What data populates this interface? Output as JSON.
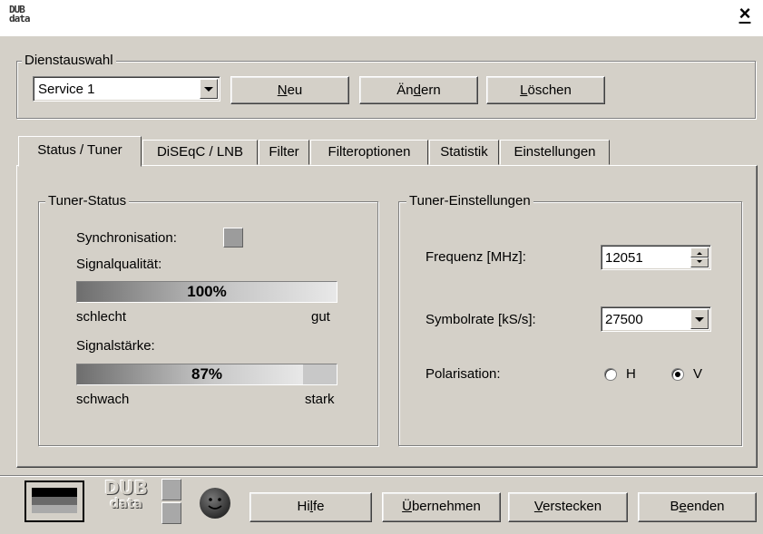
{
  "titlebar": {
    "logo_line1": "DUB",
    "logo_line2": "data",
    "close_label": "×"
  },
  "dienstauswahl": {
    "legend": "Dienstauswahl",
    "service_value": "Service 1",
    "btn_neu": {
      "pre": "",
      "u": "N",
      "post": "eu"
    },
    "btn_aendern": {
      "pre": "Än",
      "u": "d",
      "post": "ern"
    },
    "btn_loeschen": {
      "pre": "",
      "u": "L",
      "post": "öschen"
    }
  },
  "tabs": [
    "Status / Tuner",
    "DiSEqC / LNB",
    "Filter",
    "Filteroptionen",
    "Statistik",
    "Einstellungen"
  ],
  "tuner_status": {
    "legend": "Tuner-Status",
    "sync_label": "Synchronisation:",
    "quality_label": "Signalqualität:",
    "quality_value": 100,
    "quality_text": "100%",
    "quality_low": "schlecht",
    "quality_high": "gut",
    "strength_label": "Signalstärke:",
    "strength_value": 87,
    "strength_text": "87%",
    "strength_low": "schwach",
    "strength_high": "stark"
  },
  "tuner_settings": {
    "legend": "Tuner-Einstellungen",
    "freq_label": "Frequenz [MHz]:",
    "freq_value": "12051",
    "symbol_label": "Symbolrate [kS/s]:",
    "symbol_value": "27500",
    "pol_label": "Polarisation:",
    "pol_h": "H",
    "pol_v": "V",
    "pol_selected": "V"
  },
  "bottom": {
    "logo_line1": "DUB",
    "logo_line2": "data",
    "btn_hilfe": {
      "pre": "Hi",
      "u": "l",
      "post": "fe"
    },
    "btn_uebernehmen": {
      "pre": "",
      "u": "Ü",
      "post": "bernehmen"
    },
    "btn_verstecken": {
      "pre": "",
      "u": "V",
      "post": "erstecken"
    },
    "btn_beenden": {
      "pre": "B",
      "u": "e",
      "post": "enden"
    }
  }
}
